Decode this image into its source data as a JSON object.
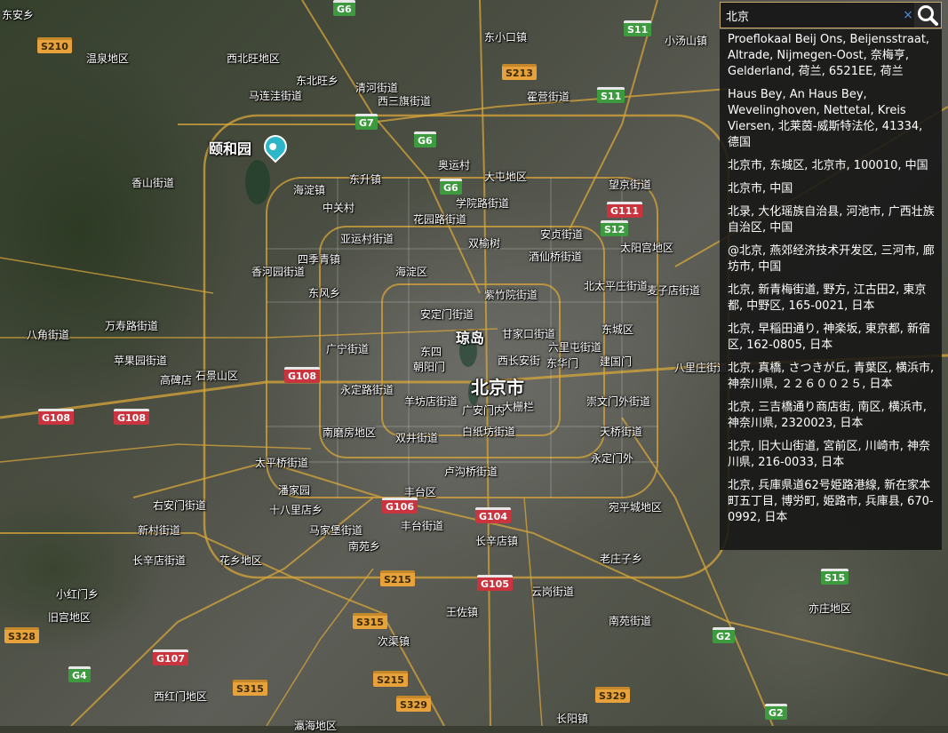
{
  "search": {
    "query": "北京",
    "clear_symbol": "×",
    "results": [
      "Proeflokaal Beij Ons, Beijensstraat, Altrade, Nijmegen-Oost, 奈梅亨, Gelderland, 荷兰, 6521EE, 荷兰",
      "Haus Bey, An Haus Bey, Wevelinghoven, Nettetal, Kreis Viersen, 北莱茵-威斯特法伦, 41334, 德国",
      "北京市, 东城区, 北京市, 100010, 中国",
      "北京市, 中国",
      "北录, 大化瑶族自治县, 河池市, 广西壮族自治区, 中国",
      "@北京, 燕郊经济技术开发区, 三河市, 廊坊市, 中国",
      "北京, 新青梅街道, 野方, 江古田2, 東京都, 中野区, 165-0021, 日本",
      "北京, 早稲田通り, 神楽坂, 東京都, 新宿区, 162-0805, 日本",
      "北京, 真橋, さつきが丘, 青葉区, 横浜市, 神奈川県, ２２６００２５, 日本",
      "北京, 三吉橋通り商店街, 南区, 横浜市, 神奈川県, 2320023, 日本",
      "北京, 旧大山街道, 宮前区, 川崎市, 神奈川県, 216-0033, 日本",
      "北京, 兵庫県道62号姫路港線, 新在家本町五丁目, 博労町, 姫路市, 兵庫县, 670-0992, 日本"
    ]
  },
  "map": {
    "poi": "颐和园",
    "city_label": "北京市",
    "big_labels": [
      "琼岛"
    ],
    "places": [
      "东安乡",
      "西北旺地区",
      "温泉地区",
      "东北旺乡",
      "马连洼街道",
      "清河街道",
      "西三旗街道",
      "东小口镇",
      "小汤山镇",
      "霍营街道",
      "东升镇",
      "香山街道",
      "奥运村",
      "大屯地区",
      "海淀镇",
      "学院路街道",
      "中关村",
      "望京街道",
      "花园路街道",
      "亚运村街道",
      "双榆树",
      "安贞街道",
      "太阳宫地区",
      "酒仙桥街道",
      "香河园街道",
      "四季青镇",
      "海淀区",
      "北太平庄街道",
      "麦子店街道",
      "东风乡",
      "紫竹院街道",
      "安定门街道",
      "万寿路街道",
      "苹果园街道",
      "八角街道",
      "广宁街道",
      "甘家口街道",
      "东城区",
      "六里屯街道",
      "东四",
      "朝阳门",
      "西长安街",
      "东华门",
      "建国门",
      "八里庄街道",
      "高碑店",
      "石景山区",
      "永定路街道",
      "羊坊店街道",
      "广安门内",
      "大栅栏",
      "崇文门外街道",
      "双井街道",
      "白纸坊街道",
      "天桥街道",
      "南磨房地区",
      "太平桥街道",
      "卢沟桥街道",
      "永定门外",
      "潘家园",
      "丰台区",
      "右安门街道",
      "宛平城地区",
      "十八里店乡",
      "丰台街道",
      "马家堡街道",
      "长辛店镇",
      "新村街道",
      "南苑乡",
      "长辛店街道",
      "花乡地区",
      "老庄子乡",
      "小红门乡",
      "云岗街道",
      "旧宫地区",
      "王佐镇",
      "南苑街道",
      "亦庄地区",
      "次渠镇",
      "西红门地区",
      "长阳镇",
      "瀛海地区"
    ],
    "shields": [
      {
        "t": "S210",
        "k": "S"
      },
      {
        "t": "S11",
        "k": "grn"
      },
      {
        "t": "S213",
        "k": "S"
      },
      {
        "t": "S11",
        "k": "grn"
      },
      {
        "t": "G7",
        "k": "grn"
      },
      {
        "t": "G6",
        "k": "grn"
      },
      {
        "t": "G6",
        "k": "grn"
      },
      {
        "t": "G111",
        "k": "G"
      },
      {
        "t": "S12",
        "k": "grn"
      },
      {
        "t": "G108",
        "k": "G"
      },
      {
        "t": "G108",
        "k": "G"
      },
      {
        "t": "G108",
        "k": "G"
      },
      {
        "t": "G106",
        "k": "G"
      },
      {
        "t": "G104",
        "k": "G"
      },
      {
        "t": "S215",
        "k": "S"
      },
      {
        "t": "G105",
        "k": "G"
      },
      {
        "t": "S315",
        "k": "S"
      },
      {
        "t": "S328",
        "k": "S"
      },
      {
        "t": "G107",
        "k": "G"
      },
      {
        "t": "G4",
        "k": "grn"
      },
      {
        "t": "S315",
        "k": "S"
      },
      {
        "t": "S215",
        "k": "S"
      },
      {
        "t": "S329",
        "k": "S"
      },
      {
        "t": "S329",
        "k": "S"
      },
      {
        "t": "S15",
        "k": "grn"
      },
      {
        "t": "G2",
        "k": "grn"
      },
      {
        "t": "G2",
        "k": "grn"
      },
      {
        "t": "G6",
        "k": "grn"
      }
    ]
  }
}
